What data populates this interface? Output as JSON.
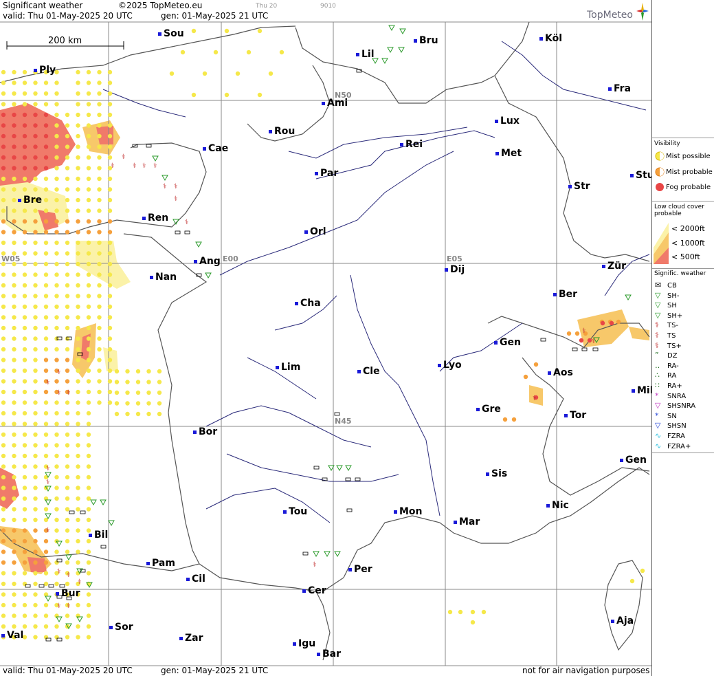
{
  "header": {
    "title": "Significant weather",
    "copyright": "©2025 TopMeteo.eu",
    "ghost1": "Thu 20",
    "ghost2": "9010",
    "valid": "valid:  Thu  01-May-2025  20 UTC",
    "gen": "gen:  01-May-2025  21 UTC",
    "logo": "TopMeteo"
  },
  "footer": {
    "valid": "valid:  Thu  01-May-2025  20 UTC",
    "gen": "gen:  01-May-2025  21 UTC",
    "disclaimer": "not for air navigation purposes"
  },
  "scale": {
    "label": "200 km"
  },
  "grid_labels": {
    "n50": "N50",
    "n45": "N45",
    "w05": "W05",
    "e00": "E00",
    "e05": "E05"
  },
  "cities": [
    {
      "name": "Sou"
    },
    {
      "name": "Bru"
    },
    {
      "name": "Köl"
    },
    {
      "name": "Lil"
    },
    {
      "name": "Ply"
    },
    {
      "name": "Ami"
    },
    {
      "name": "Fra"
    },
    {
      "name": "Rou"
    },
    {
      "name": "Lux"
    },
    {
      "name": "Cae"
    },
    {
      "name": "Rei"
    },
    {
      "name": "Met"
    },
    {
      "name": "Par"
    },
    {
      "name": "Stu"
    },
    {
      "name": "Str"
    },
    {
      "name": "Bre"
    },
    {
      "name": "Ren"
    },
    {
      "name": "Orl"
    },
    {
      "name": "Ang"
    },
    {
      "name": "Dij"
    },
    {
      "name": "Zür"
    },
    {
      "name": "Nan"
    },
    {
      "name": "Ber"
    },
    {
      "name": "Cha"
    },
    {
      "name": "Gen"
    },
    {
      "name": "Lim"
    },
    {
      "name": "Cle"
    },
    {
      "name": "Lyo"
    },
    {
      "name": "Aos"
    },
    {
      "name": "Mil"
    },
    {
      "name": "Gre"
    },
    {
      "name": "Tor"
    },
    {
      "name": "Bor"
    },
    {
      "name": "Gen"
    },
    {
      "name": "Sis"
    },
    {
      "name": "Tou"
    },
    {
      "name": "Mon"
    },
    {
      "name": "Nic"
    },
    {
      "name": "Mar"
    },
    {
      "name": "Bil"
    },
    {
      "name": "Per"
    },
    {
      "name": "Pam"
    },
    {
      "name": "Cil"
    },
    {
      "name": "Cer"
    },
    {
      "name": "Bur"
    },
    {
      "name": "Sor"
    },
    {
      "name": "Val"
    },
    {
      "name": "Zar"
    },
    {
      "name": "Aja"
    },
    {
      "name": "Igu"
    },
    {
      "name": "Bar"
    }
  ],
  "legend": {
    "visibility_title": "Visibility",
    "mist_possible": "Mist possible",
    "mist_probable": "Mist probable",
    "fog_probable": "Fog probable",
    "lowcloud_title": "Low cloud cover probable",
    "lc_2000": "< 2000ft",
    "lc_1000": "< 1000ft",
    "lc_500": "<   500ft",
    "sigwx_title": "Signific. weather",
    "items": [
      "CB",
      "SH-",
      "SH",
      "SH+",
      "TS-",
      "TS",
      "TS+",
      "DZ",
      "RA-",
      "RA",
      "RA+",
      "SNRA",
      "SHSNRA",
      "SN",
      "SHSN",
      "FZRA",
      "FZRA+"
    ]
  },
  "colors": {
    "mist_possible": "#f5e84a",
    "mist_probable": "#f5a03c",
    "fog_probable": "#e84646",
    "lowcloud_2000": "#fbf2a8",
    "lowcloud_1000": "#f7c86a",
    "lowcloud_500": "#f07a6a",
    "river": "#2a2a7a",
    "border": "#555555",
    "city_marker": "#1a1ad8"
  }
}
